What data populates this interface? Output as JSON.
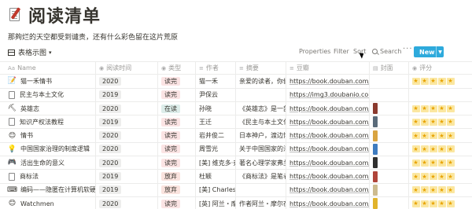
{
  "page": {
    "title": "阅读清单",
    "description": "那夠烂的天空都受到谴责，还有什么彩色留在这片荒原"
  },
  "toolbar": {
    "view_label": "表格示图",
    "properties": "Properties",
    "filter": "Filter",
    "sort": "Sort",
    "search": "Search",
    "more": "···",
    "new": "New"
  },
  "columns": [
    "Name",
    "阅读时间",
    "类型",
    "作者",
    "摘要",
    "豆瓣",
    "封面",
    "评分"
  ],
  "colors": {
    "accent": "#2eaadc",
    "tag_year_bg": "#ededec",
    "tag_read_bg": "#fbe4e4",
    "tag_reading_bg": "#ddedea",
    "tag_dropped_bg": "#fae3de"
  },
  "rows": [
    {
      "icon": "doc-pen-icon",
      "glyph": "📝",
      "name": "猫一禾情书",
      "year": "2020",
      "type": "读完",
      "author": "猫一禾",
      "summary": "亲爱的读者，你们好",
      "douban": "https://book.douban.com/sub",
      "cover": "",
      "rating": 5
    },
    {
      "icon": "page-icon",
      "glyph": "",
      "name": "民主与本土文化",
      "year": "2019",
      "type": "读完",
      "author": "尹保云",
      "summary": "",
      "douban": "https://img3.doubanio.com/vie",
      "cover": "",
      "rating": 0
    },
    {
      "icon": "pick-icon",
      "glyph": "⛏",
      "name": "英雄志",
      "year": "2020",
      "type": "在读",
      "author": "孙晓",
      "summary": "《英雄志》是一部",
      "douban": "https://book.douban.com/sub",
      "cover": "#8b3a2e",
      "rating": 5
    },
    {
      "icon": "page-icon",
      "glyph": "",
      "name": "知识产权法教程",
      "year": "2019",
      "type": "读完",
      "author": "王迁",
      "summary": "《民主与本土文化",
      "douban": "https://book.douban.com/sub",
      "cover": "#5a6b7a",
      "rating": 5
    },
    {
      "icon": "smile-icon",
      "glyph": "😊",
      "name": "情书",
      "year": "2020",
      "type": "读完",
      "author": "岩井俊二",
      "summary": "日本神户，渡边博子",
      "douban": "https://book.douban.com/sub",
      "cover": "#d9a441",
      "rating": 5
    },
    {
      "icon": "bulb-icon",
      "glyph": "💡",
      "name": "中国国家治理的制度逻辑",
      "year": "2020",
      "type": "读完",
      "author": "周雪光",
      "summary": "关于中国国家的治理",
      "douban": "https://book.douban.com/sub",
      "cover": "#3e7bbf",
      "rating": 5
    },
    {
      "icon": "gamepad-icon",
      "glyph": "🎮",
      "name": "活出生命的意义",
      "year": "2020",
      "type": "读完",
      "author": "[美] 维克多·弗",
      "summary": "著名心理学家弗兰",
      "douban": "https://book.douban.com/sub",
      "cover": "#2f2f2f",
      "rating": 5
    },
    {
      "icon": "page-icon",
      "glyph": "",
      "name": "商标法",
      "year": "2019",
      "type": "放弃",
      "author": "杜颖",
      "summary": "《商标法》是笔者",
      "douban": "https://book.douban.com/sub",
      "cover": "#b0453a",
      "rating": 5
    },
    {
      "icon": "keyboard-icon",
      "glyph": "⌨",
      "name": "编码——隐匿在计算机软硬件",
      "year": "2019",
      "type": "放弃",
      "author": "[美] Charles P",
      "summary": "",
      "douban": "https://book.douban.com/sub",
      "cover": "#cdbb8f",
      "rating": 5
    },
    {
      "icon": "smile-icon",
      "glyph": "😊",
      "name": "Watchmen",
      "year": "2020",
      "type": "读完",
      "author": "[英] 阿兰・摩尔",
      "summary": "作者阿兰・摩尔在",
      "douban": "https://book.douban.com/sub",
      "cover": "#e1b32b",
      "rating": 5
    }
  ]
}
